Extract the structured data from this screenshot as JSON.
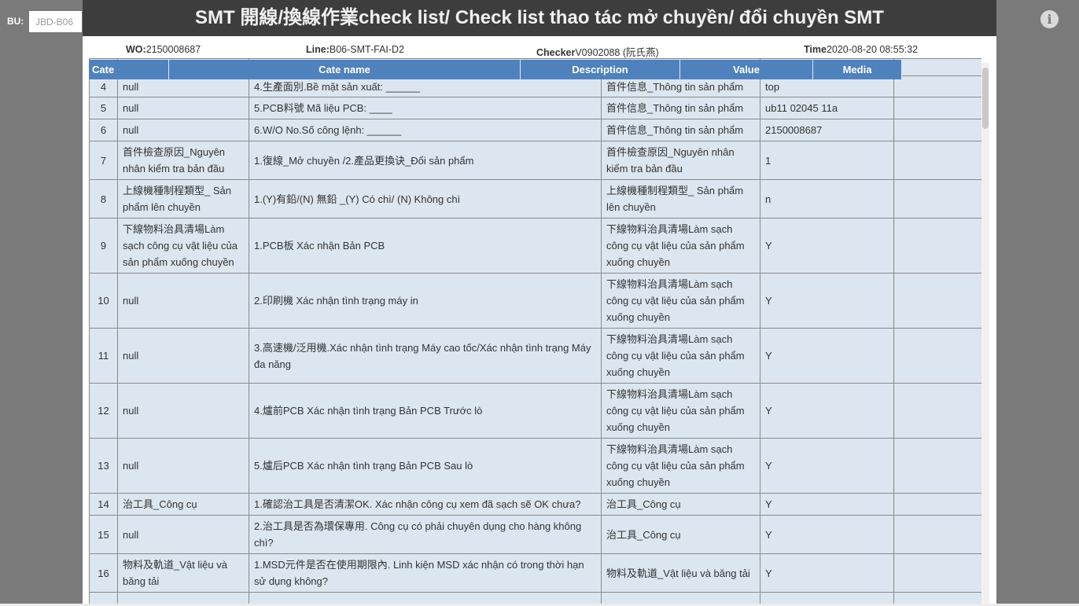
{
  "bu": {
    "label": "BU:",
    "value": "JBD-B06"
  },
  "info_icon": "info-circle-icon",
  "modal": {
    "title": "SMT 開線/換線作業check list/ Check list thao tác mở chuyền/ đổi chuyền SMT",
    "info": {
      "wo_label": "WO:",
      "wo": "2150008687",
      "line_label": "Line:",
      "line": "B06-SMT-FAI-D2",
      "checker_label": "Checker",
      "checker": "V0902088 (阮氏燕)",
      "time_label": "Time",
      "time": "2020-08-20 08:55:32"
    },
    "columns": [
      "Cate",
      "Cate name",
      "Description",
      "Value",
      "Media"
    ],
    "rows": [
      {
        "no": "4",
        "cate": "null",
        "name": "4.生產面別.Bề mặt sản xuất: ______",
        "desc": "首件信息_Thông tin sản phẩm",
        "value": "top",
        "media": ""
      },
      {
        "no": "5",
        "cate": "null",
        "name": "5.PCB料號 Mã liệu PCB: ____",
        "desc": "首件信息_Thông tin sản phẩm",
        "value": "ub11 02045 11a",
        "media": ""
      },
      {
        "no": "6",
        "cate": "null",
        "name": "6.W/O No.Số công lệnh: ______",
        "desc": "首件信息_Thông tin sản phẩm",
        "value": "2150008687",
        "media": ""
      },
      {
        "no": "7",
        "cate": "首件檢查原因_Nguyên nhân kiểm tra bản đầu",
        "name": "1.復線_Mở chuyền /2.產品更換诀_Đổi sản phẩm",
        "desc": "首件檢查原因_Nguyên nhân kiểm tra bản đầu",
        "value": "1",
        "media": ""
      },
      {
        "no": "8",
        "cate": "上線機種制程類型_ Sản phẩm lên chuyền",
        "name": "1.(Y)有鉛/(N) 無鉛 _(Y) Có chì/ (N) Không chì",
        "desc": "上線機種制程類型_ Sản phẩm lên chuyền",
        "value": "n",
        "media": ""
      },
      {
        "no": "9",
        "cate": "下線物料治具清場Làm sạch công cụ vật liệu của sản phẩm xuống chuyền",
        "name": "1.PCB板 Xác nhận Bản PCB",
        "desc": "下線物料治具清場Làm sạch công cụ vật liệu của sản phẩm xuống chuyền",
        "value": "Y",
        "media": ""
      },
      {
        "no": "10",
        "cate": "null",
        "name": "2.印刷機 Xác nhận tình trạng máy in",
        "desc": "下線物料治具清場Làm sạch công cụ vật liệu của sản phẩm xuống chuyền",
        "value": "Y",
        "media": ""
      },
      {
        "no": "11",
        "cate": "null",
        "name": "3.高速機/泛用機.Xác nhận tình trạng Máy cao tốc/Xác nhận tình trạng Máy đa năng",
        "desc": "下線物料治具清場Làm sạch công cụ vật liệu của sản phẩm xuống chuyền",
        "value": "Y",
        "media": ""
      },
      {
        "no": "12",
        "cate": "null",
        "name": "4.爐前PCB Xác nhận tình trạng Bản PCB Trước lò",
        "desc": "下線物料治具清場Làm sạch công cụ vật liệu của sản phẩm xuống chuyền",
        "value": "Y",
        "media": ""
      },
      {
        "no": "13",
        "cate": "null",
        "name": "5.爐后PCB Xác nhận tình trạng Bản PCB Sau lò",
        "desc": "下線物料治具清場Làm sạch công cụ vật liệu của sản phẩm xuống chuyền",
        "value": "Y",
        "media": ""
      },
      {
        "no": "14",
        "cate": "治工具_Công cụ",
        "name": "1.確認治工具是否清潔OK. Xác nhận công cụ xem đã sạch sẽ OK chưa?",
        "desc": "治工具_Công cụ",
        "value": "Y",
        "media": ""
      },
      {
        "no": "15",
        "cate": "null",
        "name": "2.治工具是否為環保專用. Công cụ có phải chuyên dụng cho hàng không chì?",
        "desc": "治工具_Công cụ",
        "value": "Y",
        "media": ""
      },
      {
        "no": "16",
        "cate": "物料及軌道_Vật liệu và băng tải",
        "name": "1.MSD元件是否在使用期限內. Linh kiện MSD xác nhận có trong thời hạn sử dụng không?",
        "desc": "物料及軌道_Vật liệu và băng tải",
        "value": "Y",
        "media": ""
      }
    ]
  }
}
